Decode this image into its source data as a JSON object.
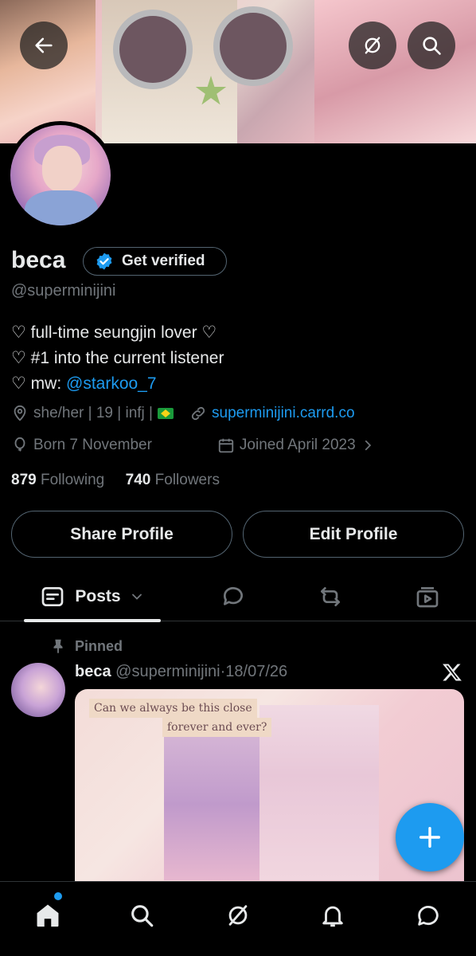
{
  "header": {
    "back_icon": "arrow-left-icon",
    "grok_icon": "grok-icon",
    "search_icon": "search-icon"
  },
  "profile": {
    "display_name": "beca",
    "verify_label": "Get verified",
    "handle": "@superminijini",
    "bio": {
      "line1": "♡ full-time seungjin lover ♡",
      "line2": "♡ #1 into the current listener",
      "line3_prefix": "♡ mw: ",
      "line3_mention": "@starkoo_7"
    },
    "location": "she/her | 19 | infj |",
    "website": "superminijini.carrd.co",
    "birthday": "Born 7 November",
    "joined": "Joined April 2023",
    "following_count": "879",
    "following_label": "Following",
    "followers_count": "740",
    "followers_label": "Followers",
    "share_button": "Share Profile",
    "edit_button": "Edit Profile"
  },
  "tabs": {
    "posts_label": "Posts"
  },
  "pinned_post": {
    "pinned_label": "Pinned",
    "author_name": "beca",
    "author_handle": "@superminijini",
    "separator": "·",
    "date": "18/07/26",
    "media_caption_line1": "Can we always be this close",
    "media_caption_line2": "forever and ever?"
  },
  "colors": {
    "accent": "#1d9bf0",
    "background": "#000000",
    "text_primary": "#e7e9ea",
    "text_secondary": "#71767b",
    "border": "#536471"
  },
  "nav": {
    "home_icon": "home-icon",
    "search_icon": "search-icon",
    "grok_icon": "grok-icon",
    "notifications_icon": "bell-icon",
    "messages_icon": "messages-icon"
  }
}
